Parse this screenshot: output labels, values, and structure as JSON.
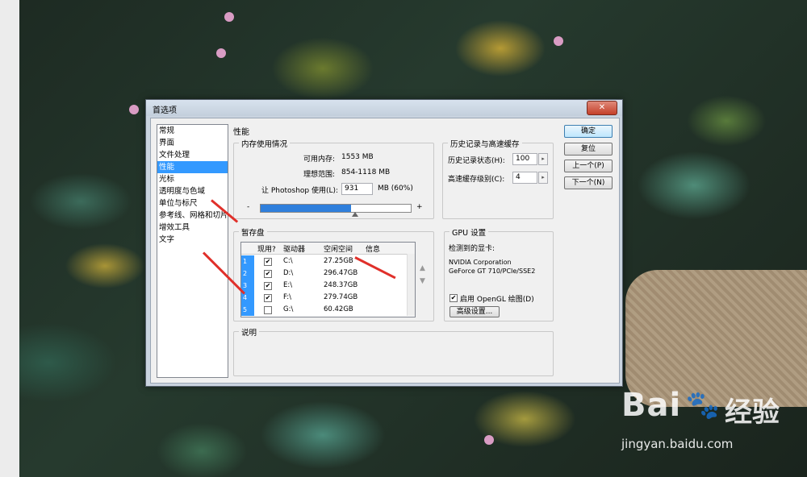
{
  "dialog": {
    "title": "首选项",
    "close_label": "✕",
    "categories": [
      {
        "label": "常规",
        "selected": false
      },
      {
        "label": "界面",
        "selected": false
      },
      {
        "label": "文件处理",
        "selected": false
      },
      {
        "label": "性能",
        "selected": true
      },
      {
        "label": "光标",
        "selected": false
      },
      {
        "label": "透明度与色域",
        "selected": false
      },
      {
        "label": "单位与标尺",
        "selected": false
      },
      {
        "label": "参考线、网格和切片",
        "selected": false
      },
      {
        "label": "增效工具",
        "selected": false
      },
      {
        "label": "文字",
        "selected": false
      }
    ],
    "panel_title": "性能",
    "memory": {
      "group_label": "内存使用情况",
      "available_label": "可用内存:",
      "available_value": "1553 MB",
      "ideal_label": "理想范围:",
      "ideal_value": "854-1118 MB",
      "use_label": "让 Photoshop 使用(L):",
      "use_value": "931",
      "use_suffix": "MB (60%)",
      "minus": "-",
      "plus": "+",
      "usage_fraction": 0.6
    },
    "history": {
      "group_label": "历史记录与高速缓存",
      "states_label": "历史记录状态(H):",
      "states_value": "100",
      "cache_label": "高速缓存级别(C):",
      "cache_value": "4"
    },
    "scratch": {
      "group_label": "暂存盘",
      "headers": {
        "active": "现用?",
        "drive": "驱动器",
        "free": "空闲空间",
        "info": "信息"
      },
      "rows": [
        {
          "num": "1",
          "checked": true,
          "check_mark": "✔",
          "drive": "C:\\",
          "free": "27.25GB"
        },
        {
          "num": "2",
          "checked": true,
          "check_mark": "✔",
          "drive": "D:\\",
          "free": "296.47GB"
        },
        {
          "num": "3",
          "checked": true,
          "check_mark": "✔",
          "drive": "E:\\",
          "free": "248.37GB"
        },
        {
          "num": "4",
          "checked": true,
          "check_mark": "✔",
          "drive": "F:\\",
          "free": "279.74GB"
        },
        {
          "num": "5",
          "checked": false,
          "check_mark": "",
          "drive": "G:\\",
          "free": "60.42GB"
        }
      ],
      "up_arrow": "▲",
      "down_arrow": "▼"
    },
    "gpu": {
      "group_label": "GPU 设置",
      "detected_label": "检测到的显卡:",
      "card_line1": "NVIDIA Corporation",
      "card_line2": "GeForce GT 710/PCIe/SSE2",
      "opengl_label": "启用 OpenGL 绘图(D)",
      "opengl_checked": true,
      "check_mark": "✔",
      "advanced_label": "高级设置..."
    },
    "description": {
      "group_label": "说明"
    },
    "buttons": {
      "ok": "确定",
      "reset": "复位",
      "prev": "上一个(P)",
      "next": "下一个(N)"
    }
  },
  "watermark": {
    "logo": "Bai",
    "paw": "🐾",
    "brand_suffix": "经验",
    "url": "jingyan.baidu.com"
  },
  "colors": {
    "selection": "#3399ff",
    "arrow": "#e0302a"
  }
}
